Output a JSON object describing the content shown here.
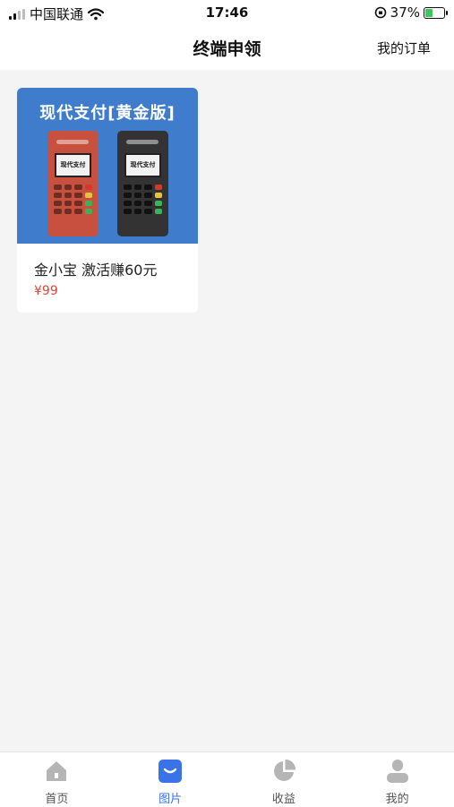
{
  "status_bar": {
    "carrier": "中国联通",
    "time": "17:46",
    "battery_percent": "37%",
    "battery_level": 0.37,
    "signal_bars": 2
  },
  "navbar": {
    "title": "终端申领",
    "orders_link": "我的订单"
  },
  "products": [
    {
      "image_banner": "现代支付[黄金版]",
      "device_screen_text": "现代支付",
      "name": "金小宝 激活赚60元",
      "price": "¥99"
    }
  ],
  "tabbar": {
    "active_index": 1,
    "accent_color": "#3a72e8",
    "items": [
      {
        "label": "首页",
        "icon": "home-icon"
      },
      {
        "label": "图片",
        "icon": "image-icon"
      },
      {
        "label": "收益",
        "icon": "pie-chart-icon"
      },
      {
        "label": "我的",
        "icon": "user-icon"
      }
    ]
  }
}
